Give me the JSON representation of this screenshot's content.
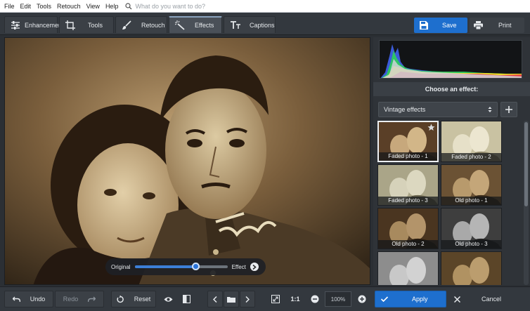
{
  "menu": {
    "items": [
      "File",
      "Edit",
      "Tools",
      "Retouch",
      "View",
      "Help"
    ],
    "search_placeholder": "What do you want to do?"
  },
  "tabs": [
    {
      "label": "Enhancement",
      "icon": "sliders-icon"
    },
    {
      "label": "Tools",
      "icon": "crop-icon"
    },
    {
      "label": "Retouch",
      "icon": "brush-icon"
    },
    {
      "label": "Effects",
      "icon": "magic-wand-icon",
      "active": true
    },
    {
      "label": "Captions",
      "icon": "text-icon"
    }
  ],
  "actions": {
    "save": "Save",
    "print": "Print"
  },
  "compare_slider": {
    "left_label": "Original",
    "right_label": "Effect",
    "level": 0.66
  },
  "panel": {
    "title": "Choose an effect:",
    "category": "Vintage effects",
    "effects": [
      {
        "label": "Faded photo - 1",
        "selected": true,
        "favorite": true
      },
      {
        "label": "Faded photo - 2"
      },
      {
        "label": "Faded photo - 3"
      },
      {
        "label": "Old photo - 1"
      },
      {
        "label": "Old photo - 2"
      },
      {
        "label": "Old photo - 3"
      },
      {
        "label": ""
      },
      {
        "label": ""
      }
    ]
  },
  "bottom": {
    "undo": "Undo",
    "redo": "Redo",
    "reset": "Reset",
    "actual_size": "1:1",
    "zoom": "100%",
    "apply": "Apply",
    "cancel": "Cancel"
  },
  "colors": {
    "accent": "#1e6fce",
    "panel": "#2f3338",
    "toolbar": "#33383e"
  }
}
